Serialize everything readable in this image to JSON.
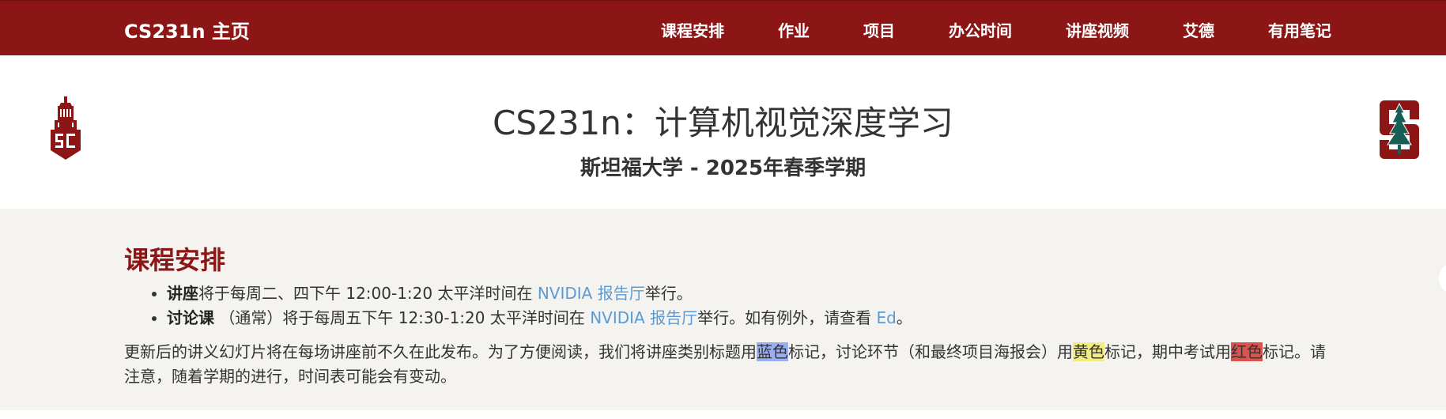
{
  "nav": {
    "brand": "CS231n 主页",
    "links": [
      "课程安排",
      "作业",
      "项目",
      "办公时间",
      "讲座视频",
      "艾德",
      "有用笔记"
    ]
  },
  "header": {
    "title": "CS231n：计算机视觉深度学习",
    "subtitle": "斯坦福大学 - 2025年春季学期"
  },
  "logos": {
    "left": "sail-tower-logo",
    "right": "stanford-tree-logo"
  },
  "schedule": {
    "heading": "课程安排",
    "lecture": {
      "label": "讲座",
      "text_before": "将于每周二、四下午 12:00-1:20 太平洋时间在 ",
      "link": "NVIDIA 报告厅",
      "text_after": "举行。"
    },
    "discussion": {
      "label": "讨论课",
      "text_before": " （通常）将于每周五下午 12:30-1:20 太平洋时间在 ",
      "link": "NVIDIA 报告厅",
      "text_mid": "举行。如有例外，请查看 ",
      "link2": "Ed",
      "text_after": "。"
    },
    "note": {
      "part1": "更新后的讲义幻灯片将在每场讲座前不久在此发布。为了方便阅读，我们将讲座类别标题用",
      "blue": "蓝色",
      "part2": "标记，讨论环节（和最终项目海报会）用",
      "yellow": "黄色",
      "part3": "标记，期中考试用",
      "red": "红色",
      "part4": "标记。请注意，随着学期的进行，时间表可能会有变动。"
    }
  },
  "colors": {
    "nav_bg": "#8c1515",
    "heading": "#8c1515",
    "link": "#5b9bd5",
    "content_bg": "#f4f3ef",
    "highlight_blue": "#9aaff2",
    "highlight_yellow": "#f2ec84",
    "highlight_red": "#d9534f"
  }
}
